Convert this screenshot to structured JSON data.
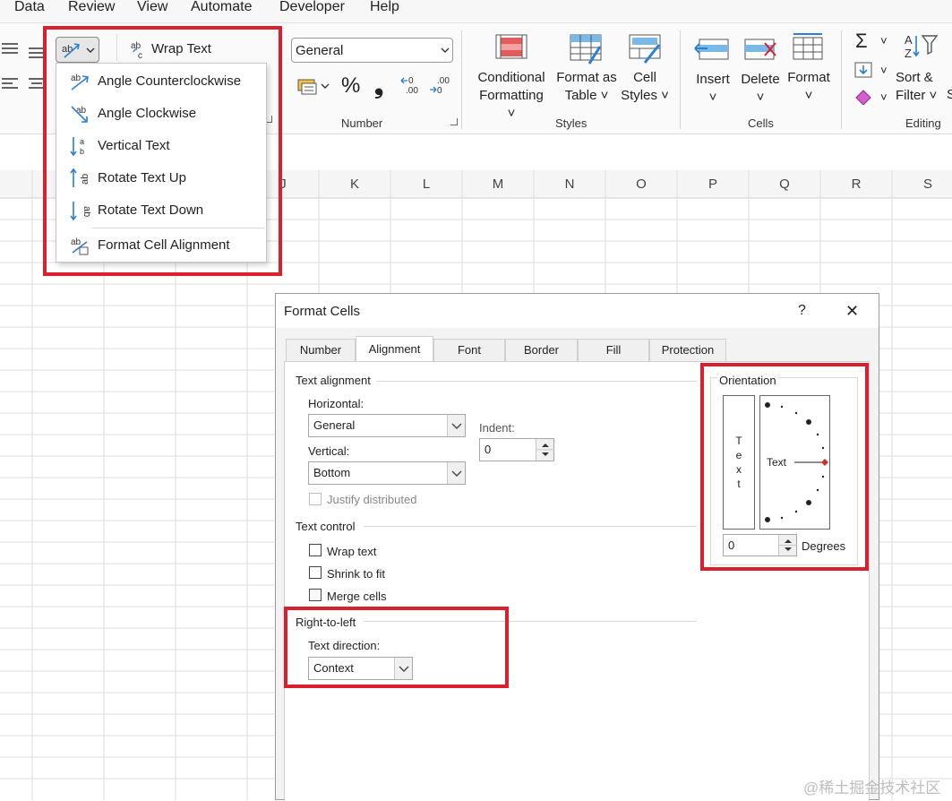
{
  "menu": [
    "Data",
    "Review",
    "View",
    "Automate",
    "Developer",
    "Help"
  ],
  "ribbon": {
    "wrap_text": "Wrap Text",
    "number_format": "General",
    "percent": "%",
    "comma": "❟",
    "inc_decimal": "←0 .00",
    "dec_decimal": ".00 →0",
    "number_group": "Number",
    "conditional": [
      "Conditional",
      "Formatting"
    ],
    "format_table": [
      "Format as",
      "Table"
    ],
    "cell_styles": [
      "Cell",
      "Styles"
    ],
    "styles_group": "Styles",
    "insert": "Insert",
    "delete": "Delete",
    "format": "Format",
    "cells_group": "Cells",
    "sigma": "Σ",
    "sort_filter": [
      "Sort &",
      "Filter"
    ],
    "sort_icon": "A Z",
    "editing_group": "Editing",
    "cut_s": "S"
  },
  "dropdown": {
    "items": [
      {
        "label": "Angle Counterclockwise",
        "icon": "angle-ccw-icon"
      },
      {
        "label": "Angle Clockwise",
        "icon": "angle-cw-icon"
      },
      {
        "label": "Vertical Text",
        "icon": "vertical-text-icon"
      },
      {
        "label": "Rotate Text Up",
        "icon": "rotate-up-icon"
      },
      {
        "label": "Rotate Text Down",
        "icon": "rotate-down-icon"
      },
      {
        "label": "Format Cell Alignment",
        "icon": "format-alignment-icon"
      }
    ]
  },
  "columns": [
    "J",
    "K",
    "L",
    "M",
    "N",
    "O",
    "P",
    "Q",
    "R",
    "S"
  ],
  "dialog": {
    "title": "Format Cells",
    "help": "?",
    "close": "✕",
    "tabs": [
      "Number",
      "Alignment",
      "Font",
      "Border",
      "Fill",
      "Protection"
    ],
    "active_tab": "Alignment",
    "text_alignment": "Text alignment",
    "horizontal_label": "Horizontal:",
    "horizontal_value": "General",
    "indent_label": "Indent:",
    "indent_value": "0",
    "vertical_label": "Vertical:",
    "vertical_value": "Bottom",
    "justify_distributed": "Justify distributed",
    "text_control": "Text control",
    "wrap_text": "Wrap text",
    "shrink_to_fit": "Shrink to fit",
    "merge_cells": "Merge cells",
    "right_to_left": "Right-to-left",
    "text_direction_label": "Text direction:",
    "text_direction_value": "Context",
    "orientation": "Orientation",
    "vertical_letters": [
      "T",
      "e",
      "x",
      "t"
    ],
    "dial_text": "Text",
    "degrees_value": "0",
    "degrees_label": "Degrees"
  },
  "watermark": "@稀土掘金技术社区",
  "colors": {
    "highlight": "#d9202c",
    "accent": "#2a7fd4"
  }
}
